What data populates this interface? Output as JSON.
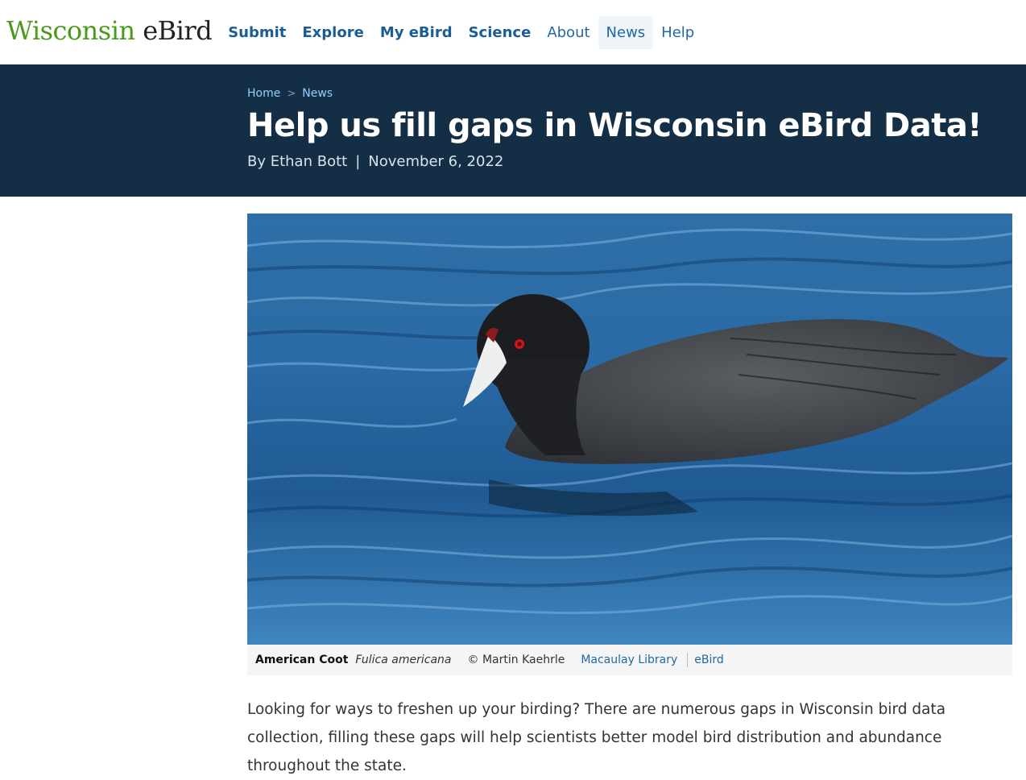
{
  "header": {
    "logo_state": "Wisconsin",
    "logo_brand": "eBird",
    "nav": [
      {
        "label": "Submit"
      },
      {
        "label": "Explore"
      },
      {
        "label": "My eBird"
      },
      {
        "label": "Science"
      },
      {
        "label": "About"
      },
      {
        "label": "News"
      },
      {
        "label": "Help"
      }
    ]
  },
  "breadcrumb": {
    "home": "Home",
    "separator": ">",
    "current": "News"
  },
  "article": {
    "title": "Help us fill gaps in Wisconsin eBird Data!",
    "byline_author": "By Ethan Bott",
    "byline_separator": "|",
    "byline_date": "November 6, 2022",
    "paragraph": "Looking for ways to freshen up your birding? There are numerous gaps in Wisconsin bird data collection, filling these gaps will help scientists better model bird distribution and abundance throughout the state."
  },
  "figure": {
    "common_name": "American Coot",
    "scientific_name": "Fulica americana",
    "credit": "© Martin Kaehrle",
    "library_link": "Macaulay Library",
    "ebird_link": "eBird"
  },
  "colors": {
    "hero_bg": "#142f45",
    "link_blue": "#1f6aa5",
    "logo_green": "#4a9a1a"
  }
}
